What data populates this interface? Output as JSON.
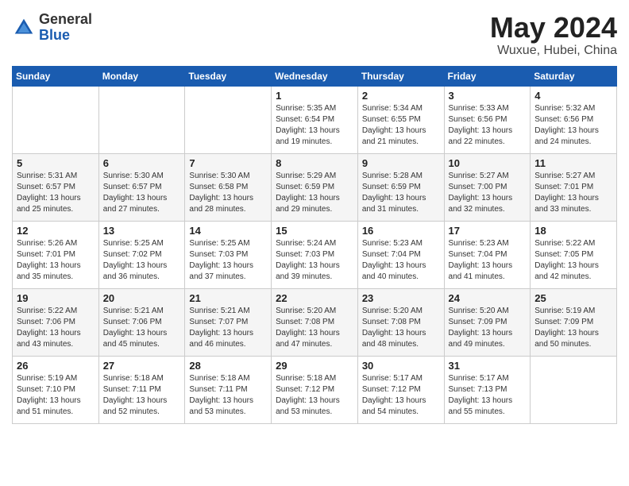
{
  "logo": {
    "general": "General",
    "blue": "Blue"
  },
  "title": "May 2024",
  "location": "Wuxue, Hubei, China",
  "weekdays": [
    "Sunday",
    "Monday",
    "Tuesday",
    "Wednesday",
    "Thursday",
    "Friday",
    "Saturday"
  ],
  "weeks": [
    [
      {
        "day": "",
        "sunrise": "",
        "sunset": "",
        "daylight": ""
      },
      {
        "day": "",
        "sunrise": "",
        "sunset": "",
        "daylight": ""
      },
      {
        "day": "",
        "sunrise": "",
        "sunset": "",
        "daylight": ""
      },
      {
        "day": "1",
        "sunrise": "Sunrise: 5:35 AM",
        "sunset": "Sunset: 6:54 PM",
        "daylight": "Daylight: 13 hours and 19 minutes."
      },
      {
        "day": "2",
        "sunrise": "Sunrise: 5:34 AM",
        "sunset": "Sunset: 6:55 PM",
        "daylight": "Daylight: 13 hours and 21 minutes."
      },
      {
        "day": "3",
        "sunrise": "Sunrise: 5:33 AM",
        "sunset": "Sunset: 6:56 PM",
        "daylight": "Daylight: 13 hours and 22 minutes."
      },
      {
        "day": "4",
        "sunrise": "Sunrise: 5:32 AM",
        "sunset": "Sunset: 6:56 PM",
        "daylight": "Daylight: 13 hours and 24 minutes."
      }
    ],
    [
      {
        "day": "5",
        "sunrise": "Sunrise: 5:31 AM",
        "sunset": "Sunset: 6:57 PM",
        "daylight": "Daylight: 13 hours and 25 minutes."
      },
      {
        "day": "6",
        "sunrise": "Sunrise: 5:30 AM",
        "sunset": "Sunset: 6:57 PM",
        "daylight": "Daylight: 13 hours and 27 minutes."
      },
      {
        "day": "7",
        "sunrise": "Sunrise: 5:30 AM",
        "sunset": "Sunset: 6:58 PM",
        "daylight": "Daylight: 13 hours and 28 minutes."
      },
      {
        "day": "8",
        "sunrise": "Sunrise: 5:29 AM",
        "sunset": "Sunset: 6:59 PM",
        "daylight": "Daylight: 13 hours and 29 minutes."
      },
      {
        "day": "9",
        "sunrise": "Sunrise: 5:28 AM",
        "sunset": "Sunset: 6:59 PM",
        "daylight": "Daylight: 13 hours and 31 minutes."
      },
      {
        "day": "10",
        "sunrise": "Sunrise: 5:27 AM",
        "sunset": "Sunset: 7:00 PM",
        "daylight": "Daylight: 13 hours and 32 minutes."
      },
      {
        "day": "11",
        "sunrise": "Sunrise: 5:27 AM",
        "sunset": "Sunset: 7:01 PM",
        "daylight": "Daylight: 13 hours and 33 minutes."
      }
    ],
    [
      {
        "day": "12",
        "sunrise": "Sunrise: 5:26 AM",
        "sunset": "Sunset: 7:01 PM",
        "daylight": "Daylight: 13 hours and 35 minutes."
      },
      {
        "day": "13",
        "sunrise": "Sunrise: 5:25 AM",
        "sunset": "Sunset: 7:02 PM",
        "daylight": "Daylight: 13 hours and 36 minutes."
      },
      {
        "day": "14",
        "sunrise": "Sunrise: 5:25 AM",
        "sunset": "Sunset: 7:03 PM",
        "daylight": "Daylight: 13 hours and 37 minutes."
      },
      {
        "day": "15",
        "sunrise": "Sunrise: 5:24 AM",
        "sunset": "Sunset: 7:03 PM",
        "daylight": "Daylight: 13 hours and 39 minutes."
      },
      {
        "day": "16",
        "sunrise": "Sunrise: 5:23 AM",
        "sunset": "Sunset: 7:04 PM",
        "daylight": "Daylight: 13 hours and 40 minutes."
      },
      {
        "day": "17",
        "sunrise": "Sunrise: 5:23 AM",
        "sunset": "Sunset: 7:04 PM",
        "daylight": "Daylight: 13 hours and 41 minutes."
      },
      {
        "day": "18",
        "sunrise": "Sunrise: 5:22 AM",
        "sunset": "Sunset: 7:05 PM",
        "daylight": "Daylight: 13 hours and 42 minutes."
      }
    ],
    [
      {
        "day": "19",
        "sunrise": "Sunrise: 5:22 AM",
        "sunset": "Sunset: 7:06 PM",
        "daylight": "Daylight: 13 hours and 43 minutes."
      },
      {
        "day": "20",
        "sunrise": "Sunrise: 5:21 AM",
        "sunset": "Sunset: 7:06 PM",
        "daylight": "Daylight: 13 hours and 45 minutes."
      },
      {
        "day": "21",
        "sunrise": "Sunrise: 5:21 AM",
        "sunset": "Sunset: 7:07 PM",
        "daylight": "Daylight: 13 hours and 46 minutes."
      },
      {
        "day": "22",
        "sunrise": "Sunrise: 5:20 AM",
        "sunset": "Sunset: 7:08 PM",
        "daylight": "Daylight: 13 hours and 47 minutes."
      },
      {
        "day": "23",
        "sunrise": "Sunrise: 5:20 AM",
        "sunset": "Sunset: 7:08 PM",
        "daylight": "Daylight: 13 hours and 48 minutes."
      },
      {
        "day": "24",
        "sunrise": "Sunrise: 5:20 AM",
        "sunset": "Sunset: 7:09 PM",
        "daylight": "Daylight: 13 hours and 49 minutes."
      },
      {
        "day": "25",
        "sunrise": "Sunrise: 5:19 AM",
        "sunset": "Sunset: 7:09 PM",
        "daylight": "Daylight: 13 hours and 50 minutes."
      }
    ],
    [
      {
        "day": "26",
        "sunrise": "Sunrise: 5:19 AM",
        "sunset": "Sunset: 7:10 PM",
        "daylight": "Daylight: 13 hours and 51 minutes."
      },
      {
        "day": "27",
        "sunrise": "Sunrise: 5:18 AM",
        "sunset": "Sunset: 7:11 PM",
        "daylight": "Daylight: 13 hours and 52 minutes."
      },
      {
        "day": "28",
        "sunrise": "Sunrise: 5:18 AM",
        "sunset": "Sunset: 7:11 PM",
        "daylight": "Daylight: 13 hours and 53 minutes."
      },
      {
        "day": "29",
        "sunrise": "Sunrise: 5:18 AM",
        "sunset": "Sunset: 7:12 PM",
        "daylight": "Daylight: 13 hours and 53 minutes."
      },
      {
        "day": "30",
        "sunrise": "Sunrise: 5:17 AM",
        "sunset": "Sunset: 7:12 PM",
        "daylight": "Daylight: 13 hours and 54 minutes."
      },
      {
        "day": "31",
        "sunrise": "Sunrise: 5:17 AM",
        "sunset": "Sunset: 7:13 PM",
        "daylight": "Daylight: 13 hours and 55 minutes."
      },
      {
        "day": "",
        "sunrise": "",
        "sunset": "",
        "daylight": ""
      }
    ]
  ]
}
